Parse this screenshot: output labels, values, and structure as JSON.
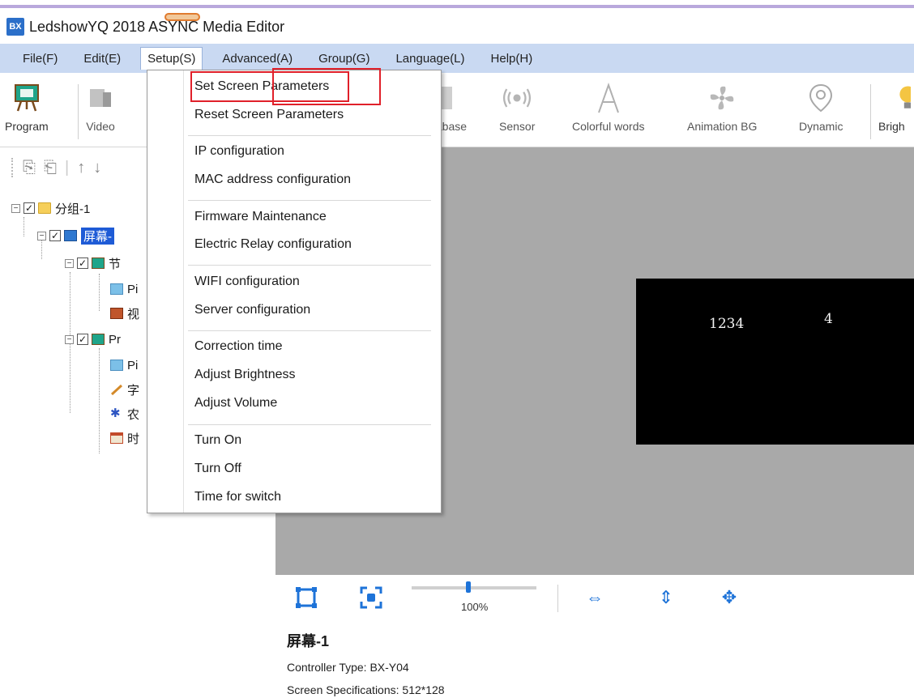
{
  "window": {
    "title": "LedshowYQ 2018 ASYNC Media Editor",
    "icon_text": "BX"
  },
  "menubar": {
    "items": [
      "File(F)",
      "Edit(E)",
      "Setup(S)",
      "Advanced(A)",
      "Group(G)",
      "Language(L)",
      "Help(H)"
    ],
    "active": "Setup(S)"
  },
  "toolbar": {
    "program": "Program",
    "video": "Video",
    "database": "tabase",
    "sensor": "Sensor",
    "colorful_words": "Colorful words",
    "animation_bg": "Animation BG",
    "dynamic": "Dynamic",
    "brightness": "Brigh"
  },
  "tree": {
    "group": "分组-1",
    "screen": "屏幕-",
    "program1": "节",
    "pic1": "Pi",
    "video1": "视",
    "program2": "Pr",
    "pic2": "Pi",
    "text2": "字",
    "lunar2": "农",
    "clock2": "时"
  },
  "setup_menu": {
    "items": [
      "Set Screen Parameters",
      "Reset Screen Parameters",
      "IP configuration",
      "MAC address configuration",
      "Firmware Maintenance",
      "Electric Relay configuration",
      "WIFI configuration",
      "Server configuration",
      "Correction time",
      "Adjust Brightness",
      "Adjust Volume",
      "Turn On",
      "Turn Off",
      "Time for switch"
    ]
  },
  "screen_preview": {
    "text1": "1234",
    "text2": "4"
  },
  "zoom": {
    "label": "100%",
    "value_percent": 100
  },
  "info": {
    "title": "屏幕-1",
    "controller": "Controller Type: BX-Y04",
    "specs": "Screen Specifications: 512*128"
  },
  "colors": {
    "menubar_bg": "#c9d9f2",
    "highlight": "#e0202a",
    "accent_blue": "#1e73d8",
    "canvas_bg": "#a9a9a9"
  }
}
